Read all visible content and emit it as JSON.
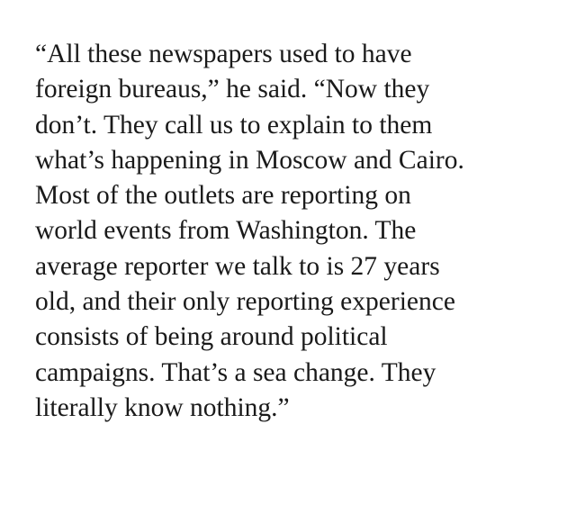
{
  "article": {
    "lines": [
      "“All these newspapers used to have",
      "foreign bureaus,” he said. “Now they",
      "don’t. They call us to explain to them",
      "what’s happening in Moscow and Cairo.",
      "Most of the outlets are reporting on",
      "world events from Washington. The",
      "average reporter we talk to is 27 years",
      "old, and their only reporting experience",
      "consists of being around political",
      "campaigns. That’s a sea change. They",
      "literally know nothing.”"
    ]
  },
  "colors": {
    "text": "#1a1a1a",
    "background": "#ffffff"
  }
}
